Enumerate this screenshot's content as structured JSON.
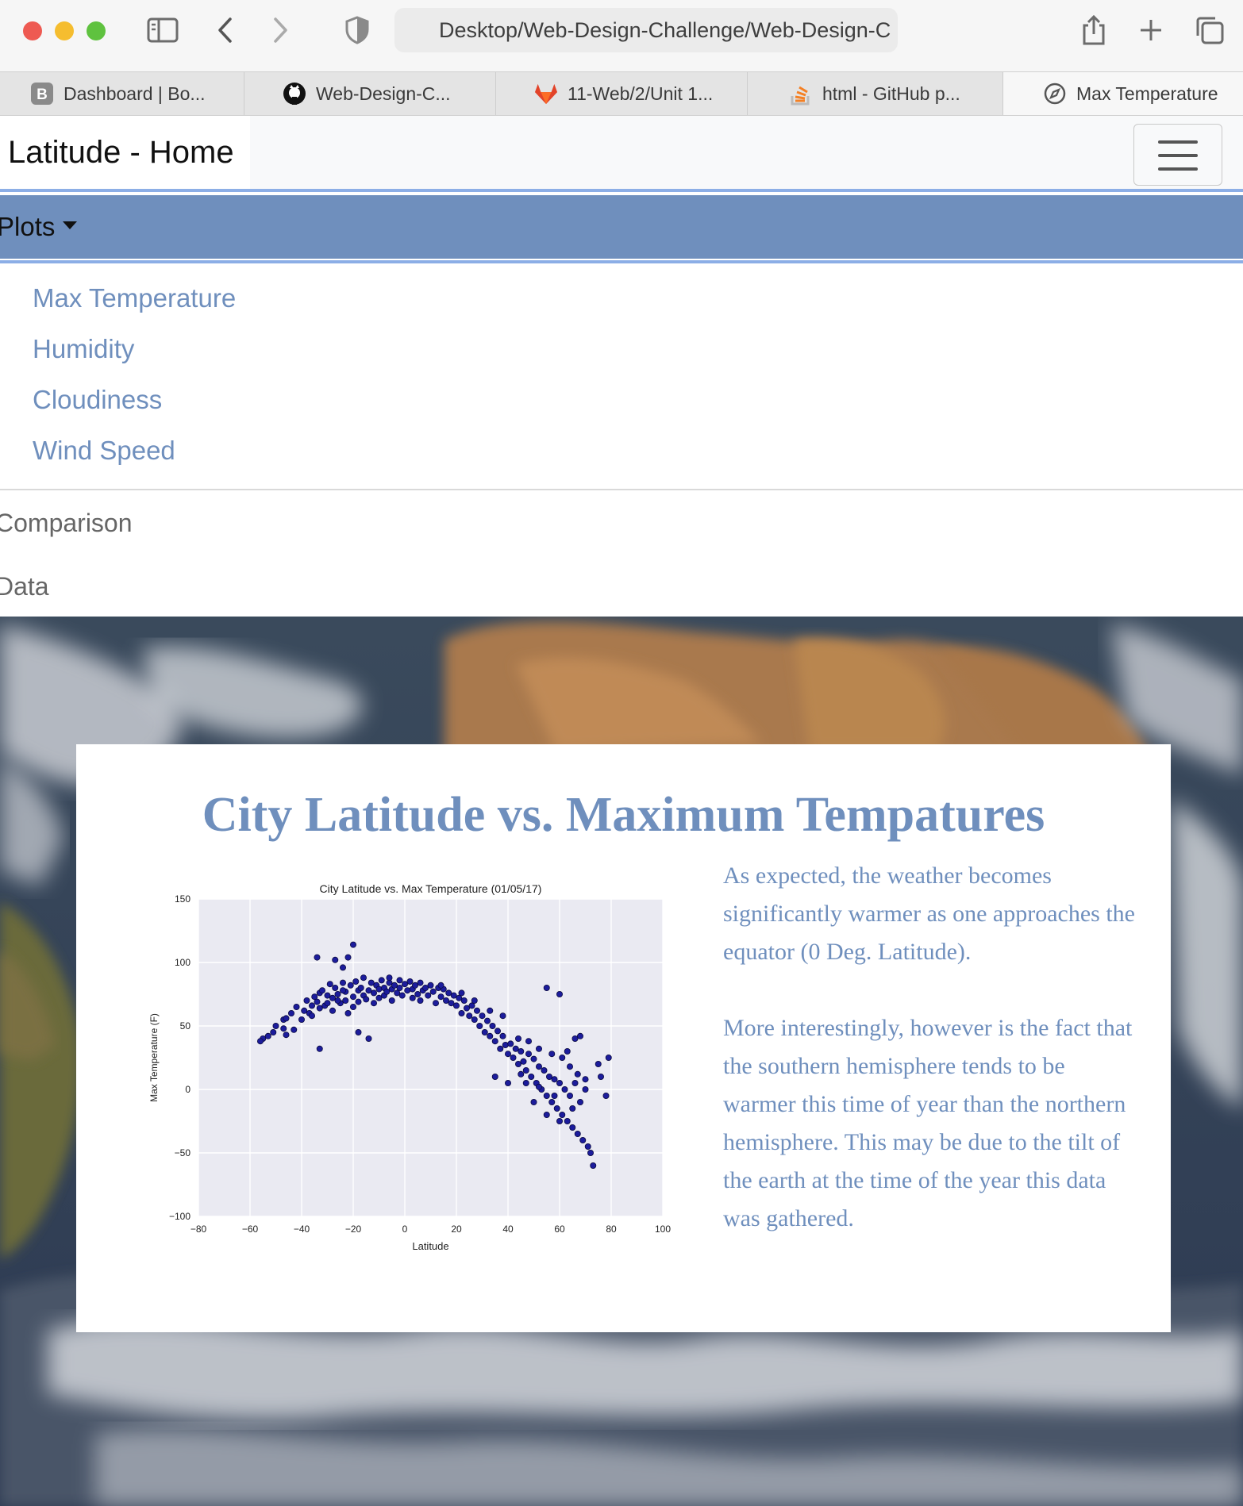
{
  "browser": {
    "url": "Desktop/Web-Design-Challenge/Web-Design-C",
    "tabs": [
      {
        "label": "Dashboard | Bo...",
        "icon": "bootstrap-icon"
      },
      {
        "label": "Web-Design-C...",
        "icon": "github-icon"
      },
      {
        "label": "11-Web/2/Unit 1...",
        "icon": "gitlab-icon"
      },
      {
        "label": "html - GitHub p...",
        "icon": "stackoverflow-icon"
      },
      {
        "label": "Max Temperature",
        "icon": "compass-icon"
      }
    ],
    "active_tab": 4
  },
  "navbar": {
    "brand": "Latitude - Home",
    "plots_label": "Plots",
    "dropdown": [
      "Max Temperature",
      "Humidity",
      "Cloudiness",
      "Wind Speed"
    ],
    "items": [
      "Comparison",
      "Data"
    ]
  },
  "card": {
    "title": "City Latitude vs. Maximum Tempatures",
    "paragraphs": [
      "As expected, the weather becomes significantly warmer as one approaches the equator (0 Deg. Latitude).",
      "More interestingly, however is the fact that the southern hemisphere tends to be warmer this time of year than the northern hemisphere. This may be due to the tilt of the earth at the time of the year this data was gathered."
    ]
  },
  "colors": {
    "accent": "#6f8fbd",
    "rule": "#8caee6",
    "chart_bg": "#eaeaf2",
    "point": "#1c1c9c"
  },
  "chart_data": {
    "type": "scatter",
    "title": "City Latitude vs. Max Temperature (01/05/17)",
    "xlabel": "Latitude",
    "ylabel": "Max Temperature (F)",
    "xlim": [
      -80,
      100
    ],
    "ylim": [
      -100,
      150
    ],
    "xticks": [
      -80,
      -60,
      -40,
      -20,
      0,
      20,
      40,
      60,
      80,
      100
    ],
    "yticks": [
      -100,
      -50,
      0,
      50,
      100,
      150
    ],
    "grid": true,
    "series": [
      {
        "points": [
          [
            -55,
            40
          ],
          [
            -53,
            42
          ],
          [
            -51,
            45
          ],
          [
            -47,
            55
          ],
          [
            -46,
            56
          ],
          [
            -47,
            48
          ],
          [
            -46,
            43
          ],
          [
            -42,
            65
          ],
          [
            -43,
            47
          ],
          [
            -39,
            62
          ],
          [
            -38,
            70
          ],
          [
            -37,
            60
          ],
          [
            -36,
            66
          ],
          [
            -35,
            73
          ],
          [
            -34,
            69
          ],
          [
            -33,
            76
          ],
          [
            -33,
            64
          ],
          [
            -32,
            78
          ],
          [
            -31,
            66
          ],
          [
            -30,
            74
          ],
          [
            -29,
            83
          ],
          [
            -28,
            72
          ],
          [
            -28,
            62
          ],
          [
            -27,
            80
          ],
          [
            -26,
            75
          ],
          [
            -25,
            68
          ],
          [
            -24,
            84
          ],
          [
            -23,
            77
          ],
          [
            -23,
            70
          ],
          [
            -22,
            60
          ],
          [
            -21,
            82
          ],
          [
            -20,
            73
          ],
          [
            -20,
            65
          ],
          [
            -19,
            85
          ],
          [
            -18,
            78
          ],
          [
            -18,
            69
          ],
          [
            -17,
            80
          ],
          [
            -16,
            74
          ],
          [
            -16,
            88
          ],
          [
            -15,
            71
          ],
          [
            -14,
            78
          ],
          [
            -13,
            84
          ],
          [
            -12,
            76
          ],
          [
            -12,
            68
          ],
          [
            -11,
            82
          ],
          [
            -10,
            79
          ],
          [
            -10,
            72
          ],
          [
            -9,
            86
          ],
          [
            -8,
            80
          ],
          [
            -8,
            74
          ],
          [
            -7,
            77
          ],
          [
            -6,
            84
          ],
          [
            -5,
            79
          ],
          [
            -5,
            70
          ],
          [
            -4,
            82
          ],
          [
            -3,
            76
          ],
          [
            -2,
            86
          ],
          [
            -2,
            80
          ],
          [
            -1,
            74
          ],
          [
            0,
            83
          ],
          [
            1,
            78
          ],
          [
            2,
            85
          ],
          [
            3,
            79
          ],
          [
            3,
            72
          ],
          [
            4,
            82
          ],
          [
            5,
            75
          ],
          [
            6,
            84
          ],
          [
            7,
            78
          ],
          [
            8,
            80
          ],
          [
            9,
            74
          ],
          [
            10,
            82
          ],
          [
            11,
            77
          ],
          [
            12,
            68
          ],
          [
            13,
            80
          ],
          [
            14,
            73
          ],
          [
            15,
            79
          ],
          [
            16,
            70
          ],
          [
            17,
            76
          ],
          [
            18,
            68
          ],
          [
            19,
            74
          ],
          [
            20,
            66
          ],
          [
            21,
            72
          ],
          [
            22,
            60
          ],
          [
            23,
            70
          ],
          [
            24,
            64
          ],
          [
            25,
            58
          ],
          [
            26,
            66
          ],
          [
            27,
            55
          ],
          [
            28,
            62
          ],
          [
            29,
            50
          ],
          [
            30,
            58
          ],
          [
            31,
            45
          ],
          [
            32,
            54
          ],
          [
            33,
            42
          ],
          [
            34,
            50
          ],
          [
            35,
            38
          ],
          [
            36,
            46
          ],
          [
            37,
            32
          ],
          [
            38,
            42
          ],
          [
            39,
            35
          ],
          [
            40,
            28
          ],
          [
            41,
            36
          ],
          [
            42,
            25
          ],
          [
            43,
            32
          ],
          [
            44,
            20
          ],
          [
            45,
            30
          ],
          [
            46,
            22
          ],
          [
            47,
            15
          ],
          [
            48,
            28
          ],
          [
            49,
            10
          ],
          [
            50,
            24
          ],
          [
            51,
            5
          ],
          [
            52,
            18
          ],
          [
            53,
            0
          ],
          [
            54,
            15
          ],
          [
            55,
            -5
          ],
          [
            56,
            10
          ],
          [
            57,
            -10
          ],
          [
            58,
            8
          ],
          [
            59,
            -15
          ],
          [
            60,
            5
          ],
          [
            61,
            -20
          ],
          [
            62,
            0
          ],
          [
            63,
            -25
          ],
          [
            64,
            -5
          ],
          [
            65,
            -30
          ],
          [
            66,
            5
          ],
          [
            67,
            -35
          ],
          [
            68,
            -10
          ],
          [
            69,
            -40
          ],
          [
            70,
            0
          ],
          [
            71,
            -45
          ],
          [
            72,
            -50
          ],
          [
            73,
            -60
          ],
          [
            75,
            20
          ],
          [
            76,
            10
          ],
          [
            78,
            -5
          ],
          [
            79,
            25
          ],
          [
            -56,
            38
          ],
          [
            -50,
            50
          ],
          [
            -44,
            60
          ],
          [
            -40,
            55
          ],
          [
            -36,
            58
          ],
          [
            -34,
            104
          ],
          [
            -27,
            102
          ],
          [
            -24,
            96
          ],
          [
            -20,
            114
          ],
          [
            -22,
            104
          ],
          [
            -33,
            32
          ],
          [
            -18,
            45
          ],
          [
            -14,
            40
          ],
          [
            55,
            80
          ],
          [
            60,
            75
          ],
          [
            63,
            30
          ],
          [
            66,
            40
          ],
          [
            68,
            42
          ],
          [
            -24,
            78
          ],
          [
            -26,
            70
          ],
          [
            -30,
            68
          ],
          [
            -6,
            88
          ],
          [
            6,
            70
          ],
          [
            14,
            82
          ],
          [
            22,
            76
          ],
          [
            27,
            70
          ],
          [
            33,
            62
          ],
          [
            38,
            58
          ],
          [
            44,
            40
          ],
          [
            48,
            38
          ],
          [
            52,
            32
          ],
          [
            57,
            28
          ],
          [
            61,
            25
          ],
          [
            64,
            18
          ],
          [
            67,
            12
          ],
          [
            70,
            8
          ],
          [
            35,
            10
          ],
          [
            40,
            5
          ],
          [
            45,
            12
          ],
          [
            50,
            -10
          ],
          [
            55,
            -20
          ],
          [
            60,
            -25
          ],
          [
            65,
            -15
          ],
          [
            58,
            -5
          ],
          [
            52,
            2
          ],
          [
            47,
            5
          ]
        ]
      }
    ]
  }
}
